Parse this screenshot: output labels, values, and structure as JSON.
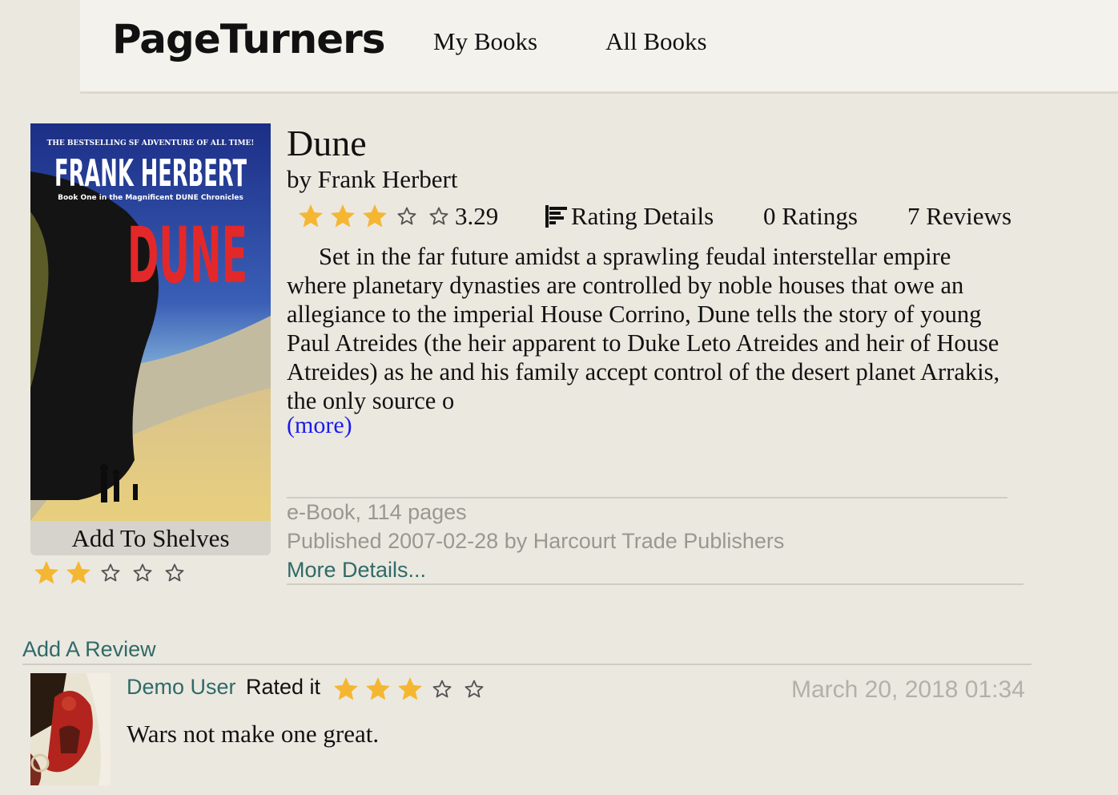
{
  "header": {
    "logo": "PageTurners",
    "nav": [
      {
        "label": "My Books"
      },
      {
        "label": "All Books"
      }
    ]
  },
  "book": {
    "cover": {
      "tagline": "THE BESTSELLING SF ADVENTURE OF ALL TIME!",
      "author": "FRANK HERBERT",
      "subtitle": "Book One in the Magnificent DUNE Chronicles",
      "title": "DUNE"
    },
    "title": "Dune",
    "byline": "by Frank Herbert",
    "average_rating": "3.29",
    "average_stars_filled": 3,
    "rating_details_label": "Rating Details",
    "ratings_count": "0 Ratings",
    "reviews_count": "7 Reviews",
    "description": "Set in the far future amidst a sprawling feudal interstellar empire where planetary dynasties are controlled by noble houses that owe an allegiance to the imperial House Corrino, Dune tells the story of young Paul Atreides (the heir apparent to Duke Leto Atreides and heir of House Atreides) as he and his family accept control of the desert planet Arrakis, the only source o",
    "more_label": "(more)",
    "format": "e-Book, 114 pages",
    "published": "Published 2007-02-28 by Harcourt Trade Publishers",
    "more_details_label": "More Details..."
  },
  "shelf": {
    "button_label": "Add To Shelves",
    "user_stars_filled": 2
  },
  "reviews_section": {
    "add_review_label": "Add A Review",
    "reviews": [
      {
        "user": "Demo User",
        "rated_label": "Rated it",
        "stars_filled": 3,
        "date": "March 20, 2018 01:34",
        "body": "Wars not make one great."
      }
    ]
  },
  "colors": {
    "star_fill": "#f5b731",
    "link_teal": "#2f6a68",
    "link_blue": "#1a1aee",
    "meta_grey": "#9a9791",
    "background": "#ebe8e0"
  }
}
